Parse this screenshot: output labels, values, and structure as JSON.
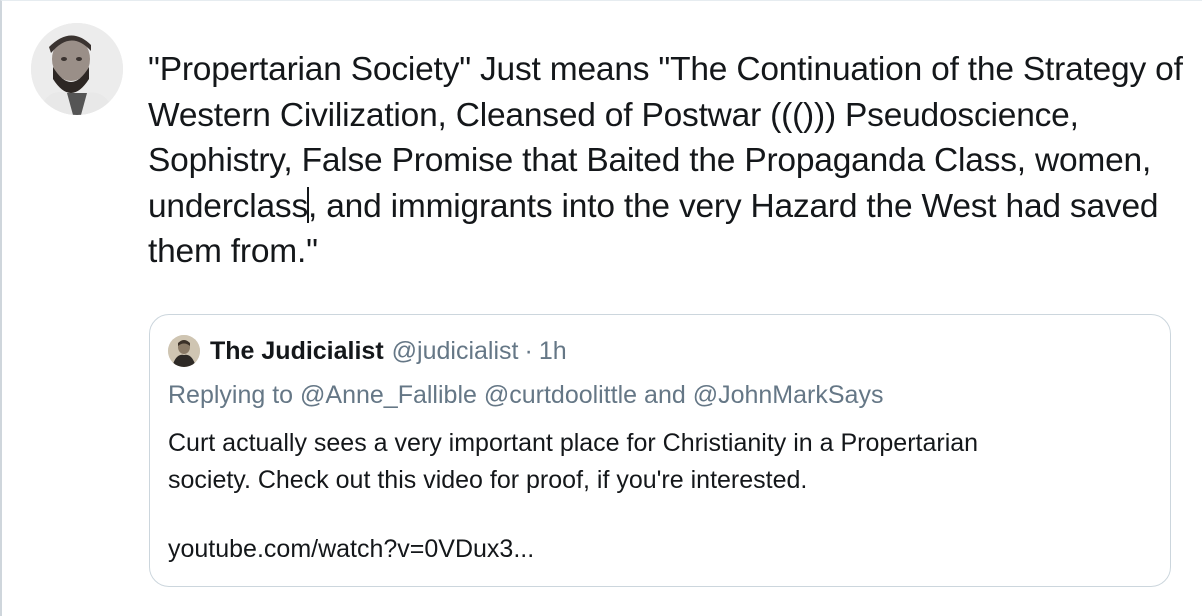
{
  "tweet": {
    "avatar_icon": "profile-photo-bearded-man",
    "text_before_caret": "\"Propertarian Society\" Just means \"The Continuation of the Strategy of Western Civilization, Cleansed of Postwar ((())) Pseudoscience, Sophistry, False Promise that Baited the Propaganda Class, women, underclass",
    "text_after_caret": ", and immigrants into the very Hazard the West had saved them from.\""
  },
  "quoted_tweet": {
    "avatar_icon": "profile-photo-portrait-painting",
    "display_name": "The Judicialist",
    "handle": "@judicialist",
    "separator": "·",
    "time": "1h",
    "replying_to_label": "Replying to",
    "mention_1": "@Anne_Fallible",
    "mention_2": "@curtdoolittle",
    "and_label": "and",
    "mention_3": "@JohnMarkSays",
    "body_line_1": "Curt actually sees a very important place for Christianity in a Propertarian",
    "body_line_2": "society. Check out this video for proof, if you're interested.",
    "link": "youtube.com/watch?v=0VDux3..."
  },
  "colors": {
    "text_primary": "#14171a",
    "text_secondary": "#657786",
    "card_border": "#ccd6dd"
  }
}
